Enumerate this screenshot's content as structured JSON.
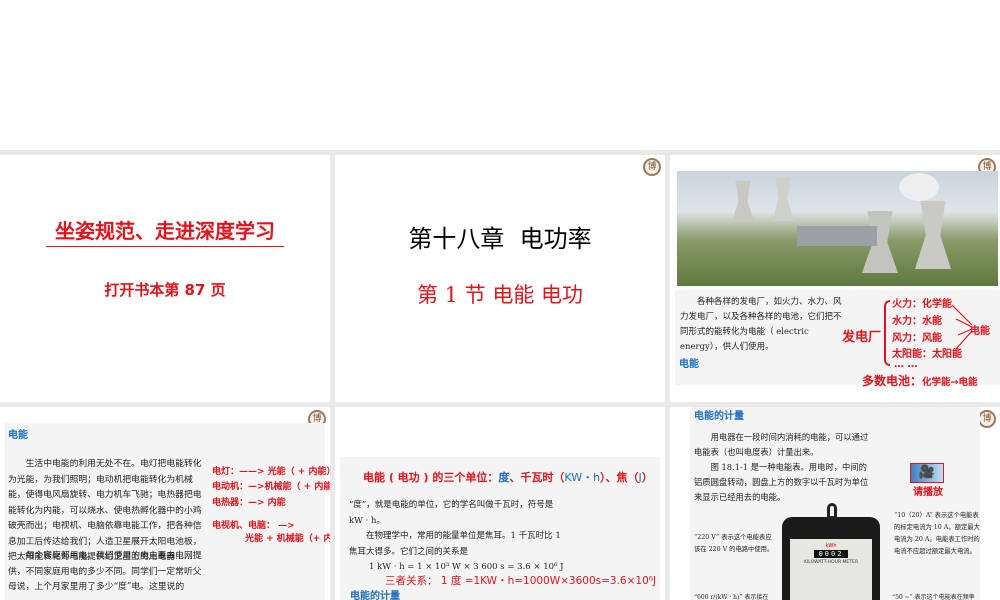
{
  "slides": [
    {
      "title": "坐姿规范、走进深度学习",
      "subtitle": "打开书本第 87 页"
    },
    {
      "title": "第十八章  电功率",
      "subtitle": "第 1 节  电能 电功"
    },
    {
      "paragraph": "各种各样的发电厂，如火力、水力、风力发电厂，以及各种各样的电池，它们把不同形式的能转化为电能（ electric energy），供人们使用。",
      "heading": "电能",
      "plant": "发电厂",
      "sources": [
        "火力：化学能",
        "水力：水能",
        "风力：风能",
        "太阳能：太阳能",
        "… …"
      ],
      "target": "电能",
      "battery": "多数电池：",
      "battery_conv": "化学能→电能"
    },
    {
      "heading": "电能",
      "para1": "生活中电能的利用无处不在。电灯把电能转化为光能，为我们照明；电动机把电能转化为机械能，使得电风扇旋转、电力机车飞驰；电热器把电能转化为内能，可以烧水、使电热孵化器中的小鸡破壳而出；电视机、电脑依靠电能工作，把各种信息加工后传达给我们；人造卫星展开太阳电池板，把太阳能转化为电能提供给卫星上的用电器……",
      "para2": "每个家庭都用电。我们使用的电主要由电网提供，不同家庭用电的多少不同。同学们一定常听父母说，上个月家里用了多少“度”电。这里说的",
      "notes": [
        "电灯：——> 光能（ + 内能）",
        "电动机：—>机械能（ + 内能）",
        "电热器：—> 内能",
        "电视机、电脑： —>",
        "光能 + 机械能（+ 内能"
      ]
    },
    {
      "units_prefix": "电能 ( 电功 ) 的三个单位：",
      "units_a": "度",
      "units_b": "、千瓦时（",
      "units_c": "KW・h",
      "units_d": "）、焦（",
      "units_e": "J",
      "units_f": "）",
      "para1": "“度”，就是电能的单位，它的学名叫做千瓦时，符号是kW · h。",
      "para2": "在物理学中，常用的能量单位是焦耳。1 千瓦时比 1 焦耳大得多。它们之间的关系是",
      "formula": "1 kW · h = 1 × 10³ W × 3 600 s = 3.6 × 10⁶ J",
      "relation": "三者关系： 1 度 =1KW・h=1000W×3600s=3.6×10⁶J",
      "footer": "电能的计量"
    },
    {
      "heading": "电能的计量",
      "para1": "用电器在一段时间内消耗的电能，可以通过电能表（也叫电度表）计量出来。",
      "para2": "图 18.1-1 是一种电能表。用电时，中间的铝质圆盘转动，圆盘上方的数字以千瓦时为单位来显示已经用去的电能。",
      "play": "请播放",
      "note_left": "“220 V” 表示这个电能表应该在 220 V 的电路中使用。",
      "note_right": "“10（20）A” 表示这个电能表的标定电流为 10 A，额定最大电流为 20 A。电能表工作时的电流不应超过额定最大电流。",
      "meter_unit": "kWh",
      "meter_digits": "0002",
      "meter_label": "KILOWATT-HOUR METER",
      "note_bl": "“600 r/(kW · h)” 表示接在",
      "note_br": "“50 ~” 表示这个电能表在频率"
    }
  ],
  "seal": "博"
}
